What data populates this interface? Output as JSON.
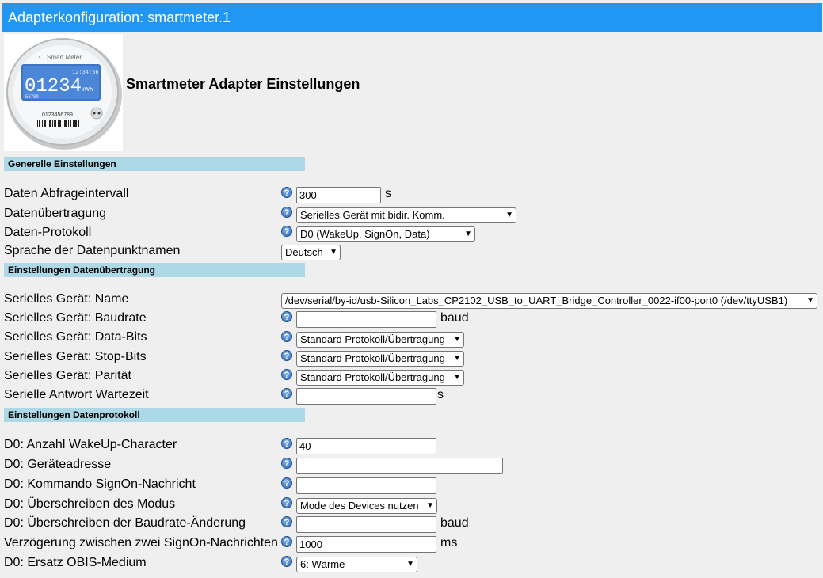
{
  "window": {
    "title": "Adapterkonfiguration: smartmeter.1"
  },
  "header": {
    "heading": "Smartmeter Adapter Einstellungen"
  },
  "logo": {
    "brand": "Smart Meter",
    "time": "12:34:56",
    "reading": "01234",
    "unit": "kWh",
    "sub": "56789",
    "serial": "0123456789"
  },
  "sections": {
    "general": "Generelle Einstellungen",
    "transfer": "Einstellungen Datenübertragung",
    "protocol": "Einstellungen Datenprotokoll"
  },
  "general": {
    "interval": {
      "label": "Daten Abfrageintervall",
      "value": "300",
      "unit": "s"
    },
    "transmission": {
      "label": "Datenübertragung",
      "value": "Serielles Gerät mit bidir. Komm."
    },
    "protocol": {
      "label": "Daten-Protokoll",
      "value": "D0 (WakeUp, SignOn, Data)"
    },
    "language": {
      "label": "Sprache der Datenpunktnamen",
      "value": "Deutsch"
    }
  },
  "transfer": {
    "name": {
      "label": "Serielles Gerät: Name",
      "value": "/dev/serial/by-id/usb-Silicon_Labs_CP2102_USB_to_UART_Bridge_Controller_0022-if00-port0 (/dev/ttyUSB1)"
    },
    "baudrate": {
      "label": "Serielles Gerät: Baudrate",
      "value": "",
      "unit": "baud"
    },
    "databits": {
      "label": "Serielles Gerät: Data-Bits",
      "value": "Standard Protokoll/Übertragung"
    },
    "stopbits": {
      "label": "Serielles Gerät: Stop-Bits",
      "value": "Standard Protokoll/Übertragung"
    },
    "parity": {
      "label": "Serielles Gerät: Parität",
      "value": "Standard Protokoll/Übertragung"
    },
    "wait": {
      "label": "Serielle Antwort Wartezeit",
      "value": "",
      "unit": "s"
    }
  },
  "protocol": {
    "wakeup": {
      "label": "D0: Anzahl WakeUp-Character",
      "value": "40"
    },
    "address": {
      "label": "D0: Geräteadresse",
      "value": ""
    },
    "signon": {
      "label": "D0: Kommando SignOn-Nachricht",
      "value": ""
    },
    "mode": {
      "label": "D0: Überschreiben des Modus",
      "value": "Mode des Devices nutzen"
    },
    "baudchange": {
      "label": "D0: Überschreiben der Baudrate-Änderung",
      "value": "",
      "unit": "baud"
    },
    "delay": {
      "label": "Verzögerung zwischen zwei SignOn-Nachrichten",
      "value": "1000",
      "unit": "ms"
    },
    "obis": {
      "label": "D0: Ersatz OBIS-Medium",
      "value": "6: Wärme"
    }
  }
}
